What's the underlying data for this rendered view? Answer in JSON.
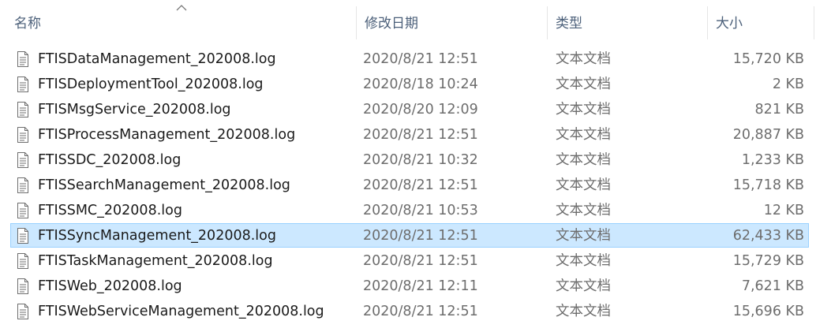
{
  "columns": {
    "name": "名称",
    "date": "修改日期",
    "type": "类型",
    "size": "大小"
  },
  "sort": {
    "column": "name",
    "direction": "ascending",
    "icon": "sort-ascending-icon"
  },
  "file_icon": "text-document-icon",
  "colors": {
    "selection_bg": "#cce8ff",
    "selection_border": "#99d1ff",
    "header_text": "#4c607a"
  },
  "files": [
    {
      "name": "FTISDataManagement_202008.log",
      "date": "2020/8/21 12:51",
      "type": "文本文档",
      "size": "15,720 KB",
      "selected": false
    },
    {
      "name": "FTISDeploymentTool_202008.log",
      "date": "2020/8/18 10:24",
      "type": "文本文档",
      "size": "2 KB",
      "selected": false
    },
    {
      "name": "FTISMsgService_202008.log",
      "date": "2020/8/20 12:09",
      "type": "文本文档",
      "size": "821 KB",
      "selected": false
    },
    {
      "name": "FTISProcessManagement_202008.log",
      "date": "2020/8/21 12:51",
      "type": "文本文档",
      "size": "20,887 KB",
      "selected": false
    },
    {
      "name": "FTISSDC_202008.log",
      "date": "2020/8/21 10:32",
      "type": "文本文档",
      "size": "1,233 KB",
      "selected": false
    },
    {
      "name": "FTISSearchManagement_202008.log",
      "date": "2020/8/21 12:51",
      "type": "文本文档",
      "size": "15,718 KB",
      "selected": false
    },
    {
      "name": "FTISSMC_202008.log",
      "date": "2020/8/21 10:53",
      "type": "文本文档",
      "size": "12 KB",
      "selected": false
    },
    {
      "name": "FTISSyncManagement_202008.log",
      "date": "2020/8/21 12:51",
      "type": "文本文档",
      "size": "62,433 KB",
      "selected": true
    },
    {
      "name": "FTISTaskManagement_202008.log",
      "date": "2020/8/21 12:51",
      "type": "文本文档",
      "size": "15,729 KB",
      "selected": false
    },
    {
      "name": "FTISWeb_202008.log",
      "date": "2020/8/21 12:11",
      "type": "文本文档",
      "size": "7,621 KB",
      "selected": false
    },
    {
      "name": "FTISWebServiceManagement_202008.log",
      "date": "2020/8/21 12:51",
      "type": "文本文档",
      "size": "15,696 KB",
      "selected": false
    }
  ]
}
